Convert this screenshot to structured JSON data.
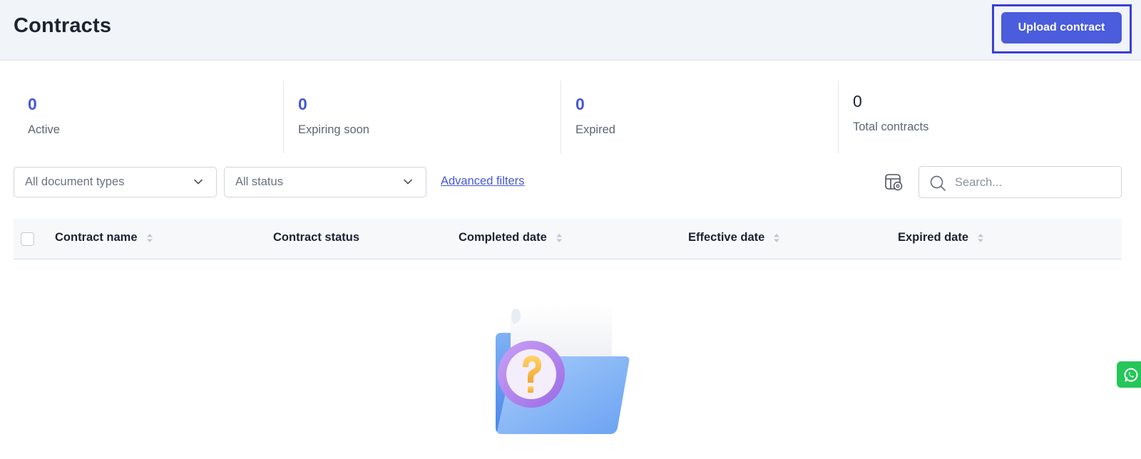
{
  "header": {
    "title": "Contracts",
    "upload_label": "Upload contract"
  },
  "stats": [
    {
      "value": "0",
      "label": "Active"
    },
    {
      "value": "0",
      "label": "Expiring soon"
    },
    {
      "value": "0",
      "label": "Expired"
    },
    {
      "value": "0",
      "label": "Total contracts"
    }
  ],
  "filters": {
    "document_type": "All document types",
    "status": "All status",
    "advanced_label": "Advanced filters"
  },
  "search": {
    "placeholder": "Search..."
  },
  "table": {
    "columns": [
      "Contract name",
      "Contract status",
      "Completed date",
      "Effective date",
      "Expired date"
    ]
  },
  "icons": {
    "column_settings": "table-settings-icon",
    "search": "search-icon",
    "chevron": "chevron-down-icon",
    "sort": "sort-icon",
    "empty_state": "empty-folder-question-icon",
    "whatsapp": "whatsapp-icon"
  },
  "colors": {
    "accent": "#4b5cdc",
    "stat_value": "#4558d6",
    "header_bg": "#f1f4f9",
    "whatsapp": "#25c65a"
  }
}
